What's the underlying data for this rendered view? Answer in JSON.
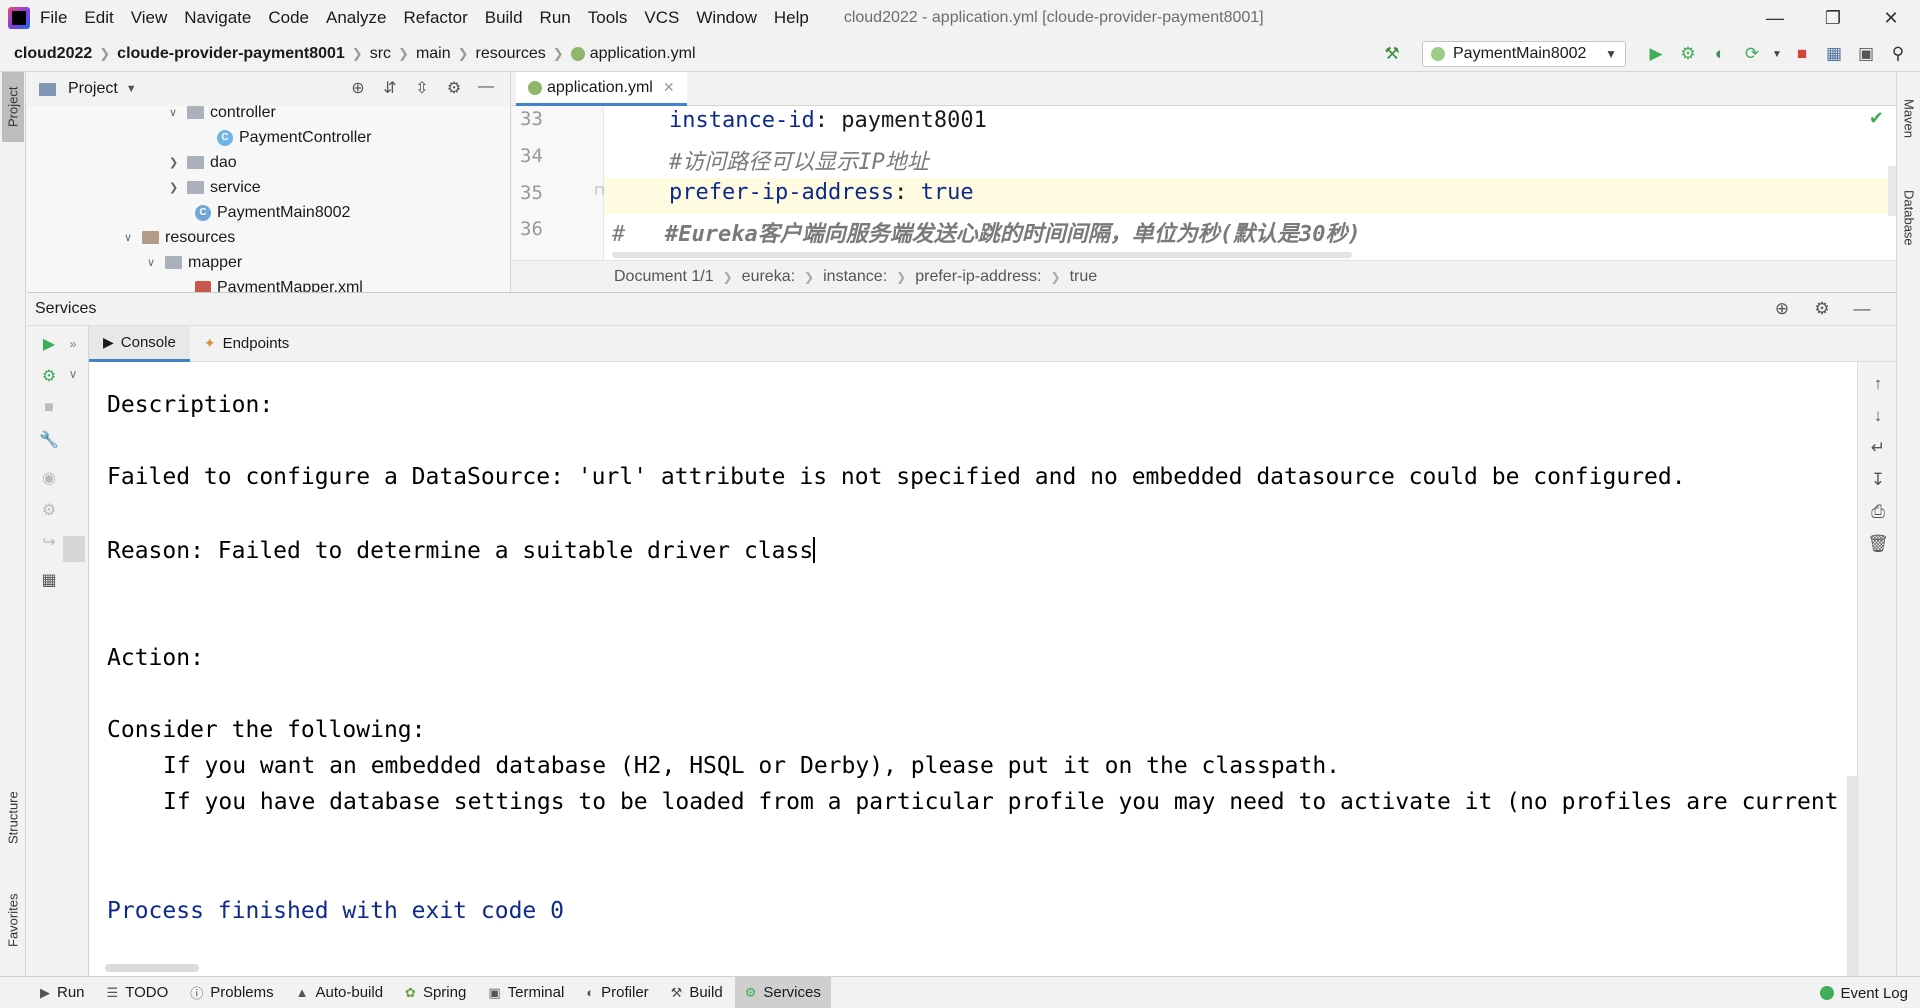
{
  "menu": {
    "items": [
      "File",
      "Edit",
      "View",
      "Navigate",
      "Code",
      "Analyze",
      "Refactor",
      "Build",
      "Run",
      "Tools",
      "VCS",
      "Window",
      "Help"
    ],
    "window_title": "cloud2022 - application.yml [cloude-provider-payment8001]"
  },
  "navbar": {
    "crumbs": [
      "cloud2022",
      "cloude-provider-payment8001",
      "src",
      "main",
      "resources",
      "application.yml"
    ],
    "run_config": "PaymentMain8002"
  },
  "left_stripe": {
    "project": "Project",
    "structure": "Structure",
    "favorites": "Favorites"
  },
  "right_stripe": {
    "maven": "Maven",
    "database": "Database"
  },
  "project": {
    "title": "Project",
    "tree": {
      "controller": "controller",
      "payment_controller": "PaymentController",
      "dao": "dao",
      "service": "service",
      "payment_main": "PaymentMain8002",
      "resources": "resources",
      "mapper": "mapper",
      "payment_mapper_xml": "PaymentMapper.xml"
    }
  },
  "editor": {
    "tab": "application.yml",
    "lines": [
      {
        "num": "33",
        "key": "instance-id",
        "value": "payment8001"
      },
      {
        "num": "34",
        "comment": "#访问路径可以显示IP地址"
      },
      {
        "num": "35",
        "key": "prefer-ip-address",
        "value": "true"
      },
      {
        "num": "36",
        "prefix": "#",
        "comment": "#Eureka客户端向服务端发送心跳的时间间隔，单位为秒(默认是30秒)"
      }
    ],
    "breadcrumbs": [
      "Document 1/1",
      "eureka:",
      "instance:",
      "prefer-ip-address:",
      "true"
    ]
  },
  "services": {
    "title": "Services",
    "tabs": {
      "console": "Console",
      "endpoints": "Endpoints"
    },
    "console_lines": {
      "description": "Description:",
      "failed": "Failed to configure a DataSource: 'url' attribute is not specified and no embedded datasource could be configured.",
      "reason": "Reason: Failed to determine a suitable driver class",
      "action": "Action:",
      "consider": "Consider the following:",
      "if1": "If you want an embedded database (H2, HSQL or Derby), please put it on the classpath.",
      "if2": "If you have database settings to be loaded from a particular profile you may need to activate it (no profiles are current",
      "finished": "Process finished with exit code 0"
    }
  },
  "bottom_bar": {
    "tabs": [
      "Run",
      "TODO",
      "Problems",
      "Auto-build",
      "Spring",
      "Terminal",
      "Profiler",
      "Build",
      "Services"
    ],
    "active": "Services",
    "event_log": "Event Log"
  },
  "colors": {
    "accent": "#4083c9",
    "keyword": "#0e2a8c",
    "comment": "#7a7a7a",
    "run_green": "#3fae5a",
    "stop_red": "#d9413b"
  }
}
